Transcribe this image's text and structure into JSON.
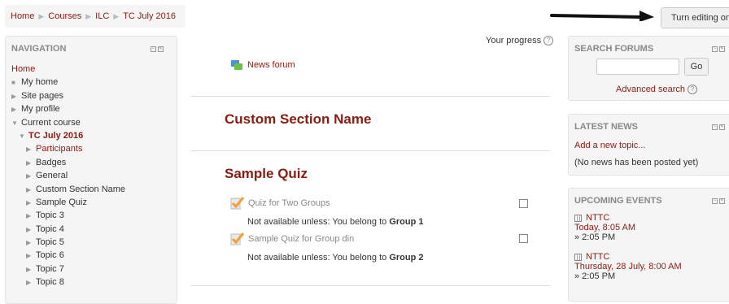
{
  "breadcrumb": [
    "Home",
    "Courses",
    "ILC",
    "TC July 2016"
  ],
  "header": {
    "edit_button": "Turn editing on"
  },
  "navigation": {
    "title": "NAVIGATION",
    "items": [
      {
        "label": "Home",
        "marker": ""
      },
      {
        "label": "My home",
        "marker": "■"
      },
      {
        "label": "Site pages",
        "marker": "▶"
      },
      {
        "label": "My profile",
        "marker": "▶"
      },
      {
        "label": "Current course",
        "marker": "▼"
      },
      {
        "label": "TC July 2016",
        "marker": "▼"
      },
      {
        "label": "Participants",
        "marker": "▶"
      },
      {
        "label": "Badges",
        "marker": "▶"
      },
      {
        "label": "General",
        "marker": "▶"
      },
      {
        "label": "Custom Section Name",
        "marker": "▶"
      },
      {
        "label": "Sample Quiz",
        "marker": "▶"
      },
      {
        "label": "Topic 3",
        "marker": "▶"
      },
      {
        "label": "Topic 4",
        "marker": "▶"
      },
      {
        "label": "Topic 5",
        "marker": "▶"
      },
      {
        "label": "Topic 6",
        "marker": "▶"
      },
      {
        "label": "Topic 7",
        "marker": "▶"
      },
      {
        "label": "Topic 8",
        "marker": "▶"
      }
    ]
  },
  "main": {
    "progress_label": "Your progress",
    "news_forum": "News forum",
    "section1_title": "Custom Section Name",
    "section2_title": "Sample Quiz",
    "activities": [
      {
        "name": "Quiz for Two Groups",
        "restriction_prefix": "Not available unless: You belong to",
        "restriction_group": "Group 1"
      },
      {
        "name": "Sample Quiz for Group din",
        "restriction_prefix": "Not available unless: You belong to",
        "restriction_group": "Group 2"
      }
    ]
  },
  "search_forums": {
    "title": "SEARCH FORUMS",
    "go_label": "Go",
    "advanced": "Advanced search",
    "input_value": ""
  },
  "latest_news": {
    "title": "LATEST NEWS",
    "add_topic": "Add a new topic...",
    "none": "(No news has been posted yet)"
  },
  "upcoming_events": {
    "title": "UPCOMING EVENTS",
    "events": [
      {
        "name": "NTTC",
        "when": "Today, 8:05 AM",
        "until": "» 2:05 PM"
      },
      {
        "name": "NTTC",
        "when": "Thursday, 28 July, 8:00 AM",
        "until": "» 2:05 PM"
      }
    ]
  },
  "icons": {
    "help": "?",
    "block_hide": "−",
    "block_dock": "<"
  },
  "colors": {
    "link": "#8b1a10",
    "block_bg": "#f5f5f5"
  }
}
